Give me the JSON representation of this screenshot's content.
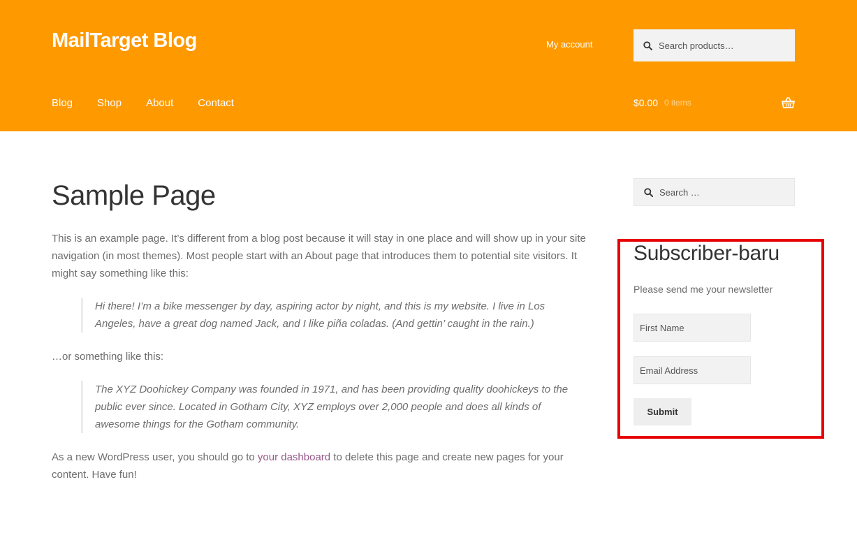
{
  "header": {
    "site_title": "MailTarget Blog",
    "my_account": "My account",
    "search_placeholder": "Search products…",
    "nav": [
      {
        "label": "Blog"
      },
      {
        "label": "Shop"
      },
      {
        "label": "About"
      },
      {
        "label": "Contact"
      }
    ],
    "cart": {
      "amount": "$0.00",
      "count": "0 items"
    }
  },
  "main": {
    "title": "Sample Page",
    "paragraph1": "This is an example page. It’s different from a blog post because it will stay in one place and will show up in your site navigation (in most themes). Most people start with an About page that introduces them to potential site visitors. It might say something like this:",
    "quote1": "Hi there! I’m a bike messenger by day, aspiring actor by night, and this is my website. I live in Los Angeles, have a great dog named Jack, and I like piña coladas. (And gettin’ caught in the rain.)",
    "paragraph2": "…or something like this:",
    "quote2": "The XYZ Doohickey Company was founded in 1971, and has been providing quality doohickeys to the public ever since. Located in Gotham City, XYZ employs over 2,000 people and does all kinds of awesome things for the Gotham community.",
    "paragraph3_before": "As a new WordPress user, you should go to ",
    "paragraph3_link": "your dashboard",
    "paragraph3_after": " to delete this page and create new pages for your content. Have fun!"
  },
  "sidebar": {
    "search_placeholder": "Search …",
    "widget": {
      "title": "Subscriber-baru",
      "description": "Please send me your newsletter",
      "first_name_placeholder": "First Name",
      "email_placeholder": "Email Address",
      "submit_label": "Submit"
    }
  },
  "colors": {
    "header_bg": "#ff9900",
    "highlight_border": "#e60000",
    "link": "#96588a"
  },
  "icons": {
    "search": "search-icon",
    "cart": "basket-icon"
  }
}
